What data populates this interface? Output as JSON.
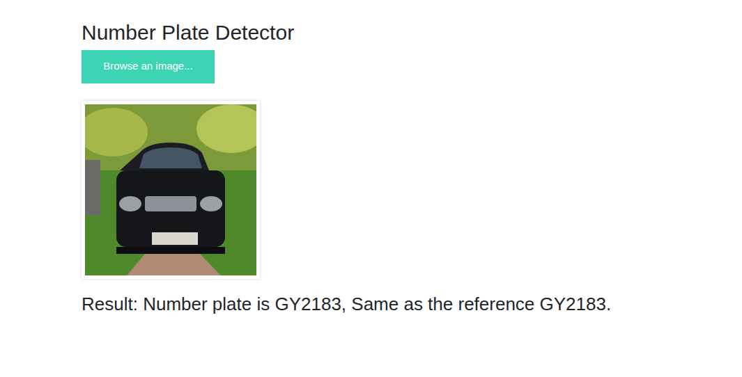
{
  "title": "Number Plate Detector",
  "upload_button": {
    "label": "Browse an image..."
  },
  "result": "Result: Number plate is GY2183, Same as the reference GY2183."
}
